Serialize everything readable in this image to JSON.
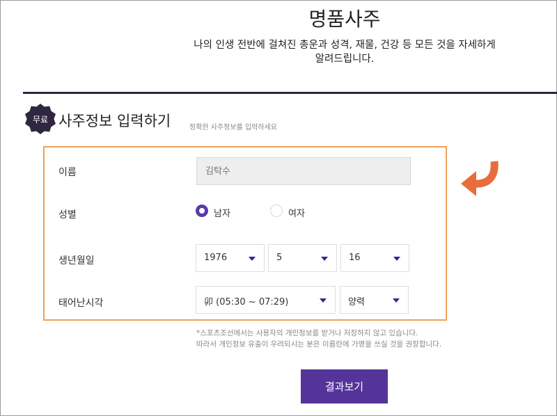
{
  "header": {
    "title": "명품사주",
    "subtitle_line1": "나의 인생 전반에 걸쳐진 총운과 성격, 재물, 건강 등 모든 것을 자세하게",
    "subtitle_line2": "알려드립니다."
  },
  "section": {
    "badge": "무료",
    "title": "사주정보 입력하기",
    "description": "정확한 사주정보를 입력하세요"
  },
  "form": {
    "name": {
      "label": "이름",
      "placeholder": "김탁수"
    },
    "gender": {
      "label": "성별",
      "options": [
        "남자",
        "여자"
      ],
      "selected": "남자"
    },
    "birth": {
      "label": "생년월일",
      "year": "1976",
      "month": "5",
      "day": "16"
    },
    "birth_time": {
      "label": "태어난시각",
      "time": "卯 (05:30 ~ 07:29)",
      "calendar": "양력"
    }
  },
  "notice": {
    "line1": "*스포츠조선에서는 사용자의 개인정보를 받거나 저장하지 않고 있습니다.",
    "line2": "따라서 개인정보 유출이 우려되시는 분은 이름란에 가명을 쓰실 것을 권장합니다."
  },
  "submit_label": "결과보기",
  "colors": {
    "accent": "#55349a",
    "highlight_border": "#f0a05a",
    "arrow": "#e86d3c",
    "badge": "#2f2740"
  },
  "icons": {
    "hint_arrow": "curved-arrow-down-left-icon",
    "dropdown": "caret-down-icon"
  }
}
